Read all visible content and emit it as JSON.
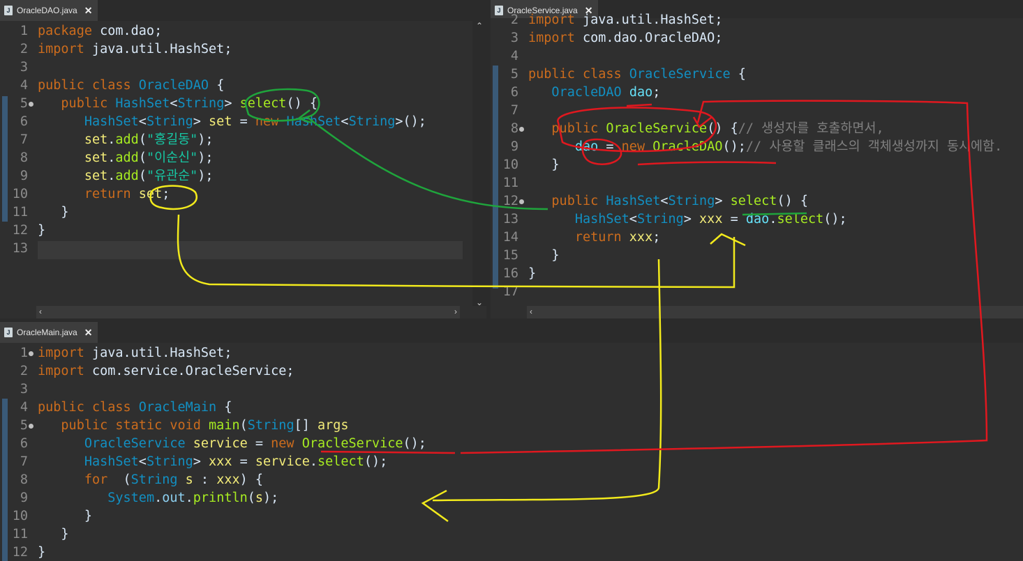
{
  "panes": {
    "dao": {
      "tab": "OracleDAO.java",
      "lines": [
        {
          "n": "1",
          "fold": false,
          "tokens": [
            [
              "kw",
              "package"
            ],
            [
              "",
              "com.dao;"
            ]
          ]
        },
        {
          "n": "2",
          "fold": false,
          "tokens": [
            [
              "kw",
              "import"
            ],
            [
              "",
              "java.util.HashSet;"
            ]
          ]
        },
        {
          "n": "3",
          "fold": false,
          "tokens": []
        },
        {
          "n": "4",
          "fold": false,
          "tokens": [
            [
              "kw",
              "public class"
            ],
            [
              "ty",
              "OracleDAO"
            ],
            [
              "",
              "{"
            ]
          ]
        },
        {
          "n": "5",
          "fold": true,
          "tokens": [
            [
              "",
              "   "
            ],
            [
              "kw",
              "public"
            ],
            [
              "ty",
              "HashSet"
            ],
            [
              "",
              "<"
            ],
            [
              "ty",
              "String"
            ],
            [
              "",
              "> "
            ],
            [
              "fn",
              "select"
            ],
            [
              "",
              "() {"
            ]
          ]
        },
        {
          "n": "6",
          "fold": false,
          "tokens": [
            [
              "",
              "      "
            ],
            [
              "ty",
              "HashSet"
            ],
            [
              "",
              "<"
            ],
            [
              "ty",
              "String"
            ],
            [
              "",
              "> "
            ],
            [
              "lv",
              "set"
            ],
            [
              "",
              " = "
            ],
            [
              "kw",
              "new"
            ],
            [
              "ty",
              "HashSet"
            ],
            [
              "",
              "<"
            ],
            [
              "ty",
              "String"
            ],
            [
              "",
              ">();"
            ]
          ]
        },
        {
          "n": "7",
          "fold": false,
          "tokens": [
            [
              "",
              "      "
            ],
            [
              "lv",
              "set"
            ],
            [
              "",
              "."
            ],
            [
              "fn",
              "add"
            ],
            [
              "",
              "("
            ],
            [
              "str",
              "\"홍길동\""
            ],
            [
              "",
              ");"
            ]
          ]
        },
        {
          "n": "8",
          "fold": false,
          "tokens": [
            [
              "",
              "      "
            ],
            [
              "lv",
              "set"
            ],
            [
              "",
              "."
            ],
            [
              "fn",
              "add"
            ],
            [
              "",
              "("
            ],
            [
              "str",
              "\"이순신\""
            ],
            [
              "",
              ");"
            ]
          ]
        },
        {
          "n": "9",
          "fold": false,
          "tokens": [
            [
              "",
              "      "
            ],
            [
              "lv",
              "set"
            ],
            [
              "",
              "."
            ],
            [
              "fn",
              "add"
            ],
            [
              "",
              "("
            ],
            [
              "str",
              "\"유관순\""
            ],
            [
              "",
              ");"
            ]
          ]
        },
        {
          "n": "10",
          "fold": false,
          "tokens": [
            [
              "",
              "      "
            ],
            [
              "kw",
              "return"
            ],
            [
              "lv",
              "set"
            ],
            [
              "",
              ";"
            ]
          ]
        },
        {
          "n": "11",
          "fold": false,
          "tokens": [
            [
              "",
              "   }"
            ]
          ]
        },
        {
          "n": "12",
          "fold": false,
          "tokens": [
            [
              "",
              "}"
            ]
          ]
        },
        {
          "n": "13",
          "fold": false,
          "tokens": []
        }
      ]
    },
    "service": {
      "tab": "OracleService.java",
      "lines": [
        {
          "n": "2",
          "fold": false,
          "tokens": [
            [
              "kw",
              "import"
            ],
            [
              "",
              "java.util.HashSet;"
            ]
          ]
        },
        {
          "n": "3",
          "fold": false,
          "tokens": [
            [
              "kw",
              "import"
            ],
            [
              "",
              "com.dao.OracleDAO;"
            ]
          ]
        },
        {
          "n": "4",
          "fold": false,
          "tokens": []
        },
        {
          "n": "5",
          "fold": false,
          "tokens": [
            [
              "kw",
              "public class"
            ],
            [
              "ty",
              "OracleService"
            ],
            [
              "",
              "{"
            ]
          ]
        },
        {
          "n": "6",
          "fold": false,
          "tokens": [
            [
              "",
              "   "
            ],
            [
              "ty",
              "OracleDAO"
            ],
            [
              "var",
              "dao"
            ],
            [
              "",
              ";"
            ]
          ]
        },
        {
          "n": "7",
          "fold": false,
          "tokens": []
        },
        {
          "n": "8",
          "fold": true,
          "tokens": [
            [
              "",
              "   "
            ],
            [
              "kw",
              "public"
            ],
            [
              "fn",
              "OracleService"
            ],
            [
              "",
              "() {"
            ],
            [
              "cm",
              "// 생성자를 호출하면서,"
            ]
          ]
        },
        {
          "n": "9",
          "fold": false,
          "tokens": [
            [
              "",
              "      "
            ],
            [
              "var",
              "dao"
            ],
            [
              "",
              " = "
            ],
            [
              "kw",
              "new"
            ],
            [
              "fn",
              "OracleDAO"
            ],
            [
              "",
              "();"
            ],
            [
              "cm",
              "// 사용할 클래스의 객체생성까지 동시에함."
            ]
          ]
        },
        {
          "n": "10",
          "fold": false,
          "tokens": [
            [
              "",
              "   }"
            ]
          ]
        },
        {
          "n": "11",
          "fold": false,
          "tokens": []
        },
        {
          "n": "12",
          "fold": true,
          "tokens": [
            [
              "",
              "   "
            ],
            [
              "kw",
              "public"
            ],
            [
              "ty",
              "HashSet"
            ],
            [
              "",
              "<"
            ],
            [
              "ty",
              "String"
            ],
            [
              "",
              "> "
            ],
            [
              "fn",
              "select"
            ],
            [
              "",
              "() {"
            ]
          ]
        },
        {
          "n": "13",
          "fold": false,
          "tokens": [
            [
              "",
              "      "
            ],
            [
              "ty",
              "HashSet"
            ],
            [
              "",
              "<"
            ],
            [
              "ty",
              "String"
            ],
            [
              "",
              "> "
            ],
            [
              "lv",
              "xxx"
            ],
            [
              "",
              " = "
            ],
            [
              "var",
              "dao"
            ],
            [
              "",
              "."
            ],
            [
              "fn",
              "select"
            ],
            [
              "",
              "();"
            ]
          ]
        },
        {
          "n": "14",
          "fold": false,
          "tokens": [
            [
              "",
              "      "
            ],
            [
              "kw",
              "return"
            ],
            [
              "lv",
              "xxx"
            ],
            [
              "",
              ";"
            ]
          ]
        },
        {
          "n": "15",
          "fold": false,
          "tokens": [
            [
              "",
              "   }"
            ]
          ]
        },
        {
          "n": "16",
          "fold": false,
          "tokens": [
            [
              "",
              "}"
            ]
          ]
        },
        {
          "n": "17",
          "fold": false,
          "tokens": []
        }
      ]
    },
    "main": {
      "tab": "OracleMain.java",
      "lines": [
        {
          "n": "1",
          "fold": true,
          "tokens": [
            [
              "kw",
              "import"
            ],
            [
              "",
              "java.util.HashSet;"
            ]
          ]
        },
        {
          "n": "2",
          "fold": false,
          "tokens": [
            [
              "kw",
              "import"
            ],
            [
              "",
              "com.service.OracleService;"
            ]
          ]
        },
        {
          "n": "3",
          "fold": false,
          "tokens": []
        },
        {
          "n": "4",
          "fold": false,
          "tokens": [
            [
              "kw",
              "public class"
            ],
            [
              "ty",
              "OracleMain"
            ],
            [
              "",
              "{"
            ]
          ]
        },
        {
          "n": "5",
          "fold": true,
          "tokens": [
            [
              "",
              "   "
            ],
            [
              "kw",
              "public static void"
            ],
            [
              "fn",
              "main"
            ],
            [
              "",
              "("
            ],
            [
              "ty",
              "String"
            ],
            [
              "",
              "[] "
            ],
            [
              "lv",
              "args"
            ],
            [
              ") {",
              ""
            ]
          ]
        },
        {
          "n": "6",
          "fold": false,
          "tokens": [
            [
              "",
              "      "
            ],
            [
              "ty",
              "OracleService"
            ],
            [
              "lv",
              "service"
            ],
            [
              "",
              " = "
            ],
            [
              "kw",
              "new"
            ],
            [
              "fn",
              "OracleService"
            ],
            [
              "",
              "();"
            ]
          ]
        },
        {
          "n": "7",
          "fold": false,
          "tokens": [
            [
              "",
              "      "
            ],
            [
              "ty",
              "HashSet"
            ],
            [
              "",
              "<"
            ],
            [
              "ty",
              "String"
            ],
            [
              "",
              "> "
            ],
            [
              "lv",
              "xxx"
            ],
            [
              "",
              " = "
            ],
            [
              "lv",
              "service"
            ],
            [
              "",
              "."
            ],
            [
              "fn",
              "select"
            ],
            [
              "",
              "();"
            ]
          ]
        },
        {
          "n": "8",
          "fold": false,
          "tokens": [
            [
              "",
              "      "
            ],
            [
              "kw",
              "for"
            ],
            [
              "",
              " ("
            ],
            [
              "ty",
              "String"
            ],
            [
              "lv",
              "s"
            ],
            [
              "",
              " : "
            ],
            [
              "lv",
              "xxx"
            ],
            [
              "",
              ") {"
            ]
          ]
        },
        {
          "n": "9",
          "fold": false,
          "tokens": [
            [
              "",
              "         "
            ],
            [
              "ty",
              "System"
            ],
            [
              "",
              "."
            ],
            [
              "st",
              "out"
            ],
            [
              "",
              "."
            ],
            [
              "fn",
              "println"
            ],
            [
              "",
              "("
            ],
            [
              "lv",
              "s"
            ],
            [
              "",
              ");"
            ]
          ]
        },
        {
          "n": "10",
          "fold": false,
          "tokens": [
            [
              "",
              "      }"
            ]
          ]
        },
        {
          "n": "11",
          "fold": false,
          "tokens": [
            [
              "",
              "   }"
            ]
          ]
        },
        {
          "n": "12",
          "fold": false,
          "tokens": [
            [
              "",
              "}"
            ]
          ]
        }
      ]
    }
  },
  "colors": {
    "annot_green": "#1fa53c",
    "annot_yellow": "#f2ea1c",
    "annot_red": "#e0181f"
  },
  "icons": {
    "file": "java-file-icon",
    "close": "close-icon"
  }
}
